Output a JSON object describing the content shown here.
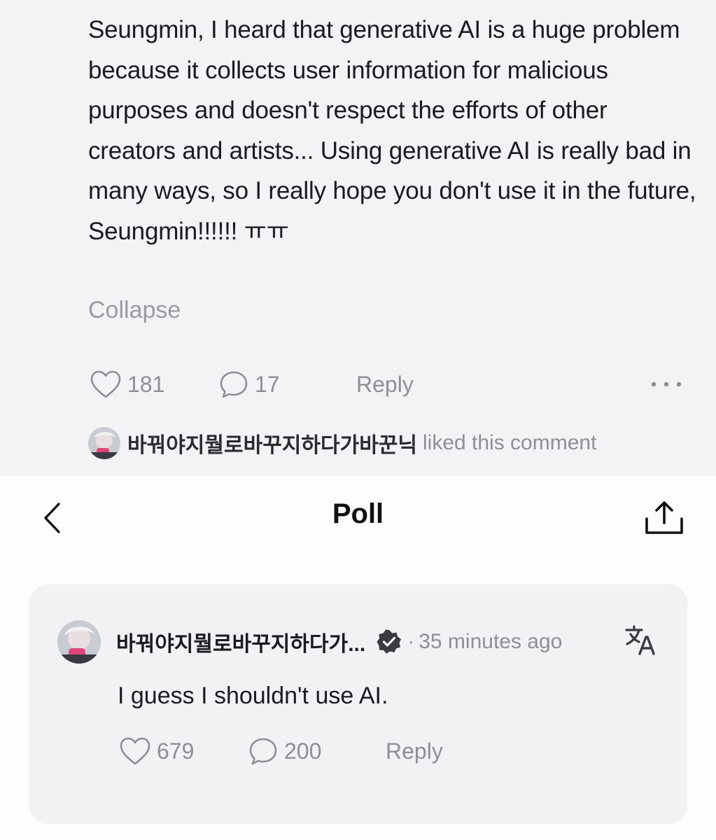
{
  "comment": {
    "text": "Seungmin, I heard that generative AI is a huge problem because it collects user information for malicious purposes and doesn't respect the efforts of other creators and artists... Using generative AI is really bad in many ways, so I really hope you don't use it in the future, Seungmin!!!!!! ㅠㅠ",
    "collapse_label": "Collapse",
    "likes": "181",
    "comments": "17",
    "reply_label": "Reply",
    "more_label": "• • •",
    "liked_by_name": "바꿔야지뭘로바꾸지하다가바꾼닉",
    "liked_by_text": "liked this comment"
  },
  "nav": {
    "title": "Poll"
  },
  "reply": {
    "author": "바꿔야지뭘로바꾸지하다가...",
    "separator": "·",
    "time": "35 minutes ago",
    "text": "I guess I shouldn't use AI.",
    "likes": "679",
    "comments": "200",
    "reply_label": "Reply"
  },
  "colors": {
    "top_background": "#f3f3f6",
    "card_background": "#f2f2f4",
    "muted_text": "#8e8e95",
    "primary_text": "#1b1b1f"
  },
  "icons": {
    "like": "heart-outline-icon",
    "comment": "speech-bubble-icon",
    "more": "more-dots-icon",
    "back": "chevron-left-icon",
    "share": "share-upload-icon",
    "verified": "verified-badge-icon",
    "translate": "translate-icon"
  }
}
